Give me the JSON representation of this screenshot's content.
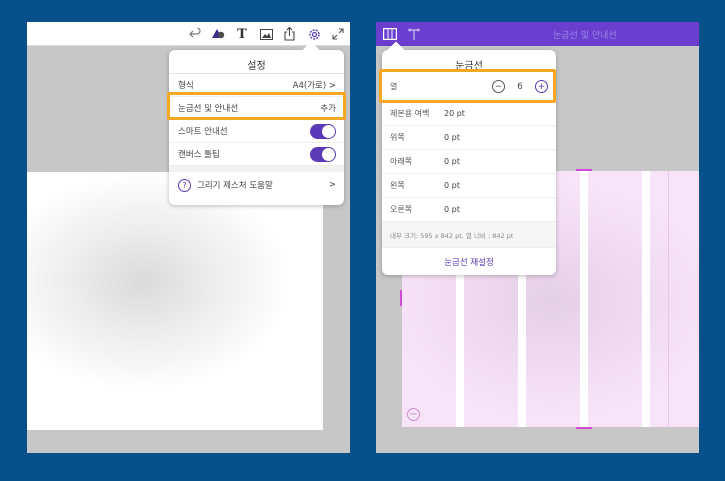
{
  "left": {
    "toolbar": {
      "icons": [
        "undo-icon",
        "shapes-icon",
        "text-icon",
        "image-icon",
        "share-icon",
        "settings-icon",
        "expand-icon"
      ],
      "text_icon_glyph": "T"
    },
    "settings": {
      "title": "설정",
      "format_label": "형식",
      "format_value": "A4(가로) >",
      "grid_label": "눈금선 및 안내선",
      "grid_value": "추가",
      "smart_guides_label": "스마트 안내선",
      "smart_guides_on": true,
      "canvas_tooltips_label": "캔버스 툴팁",
      "canvas_tooltips_on": true,
      "help_label": "그리기 제스처 도움말",
      "help_glyph": "?",
      "chevron": ">"
    }
  },
  "right": {
    "toolbar": {
      "title": "눈금선 및 안내선",
      "icons": [
        "grid-columns-icon",
        "guide-icon"
      ]
    },
    "grid": {
      "title": "눈금선",
      "columns_label": "열",
      "columns_value": "6",
      "minus": "−",
      "plus": "+",
      "bleed_label": "제본용 여백",
      "bleed_value": "20 pt",
      "top_label": "위쪽",
      "top_value": "0 pt",
      "bottom_label": "아래쪽",
      "bottom_value": "0 pt",
      "left_label": "왼쪽",
      "left_value": "0 pt",
      "right_label": "오른쪽",
      "right_value": "0 pt",
      "info": "내부 크기: 595 x 842 pt, 열 너비 : 842 pt",
      "reset_label": "눈금선 재설정"
    },
    "canvas_minus_glyph": "−"
  },
  "colors": {
    "background": "#07508c",
    "accent": "#5b3ab7",
    "toolbar_purple": "#6a3fcf",
    "highlight": "#f7a823",
    "grid_pink": "#f6e1f7"
  }
}
